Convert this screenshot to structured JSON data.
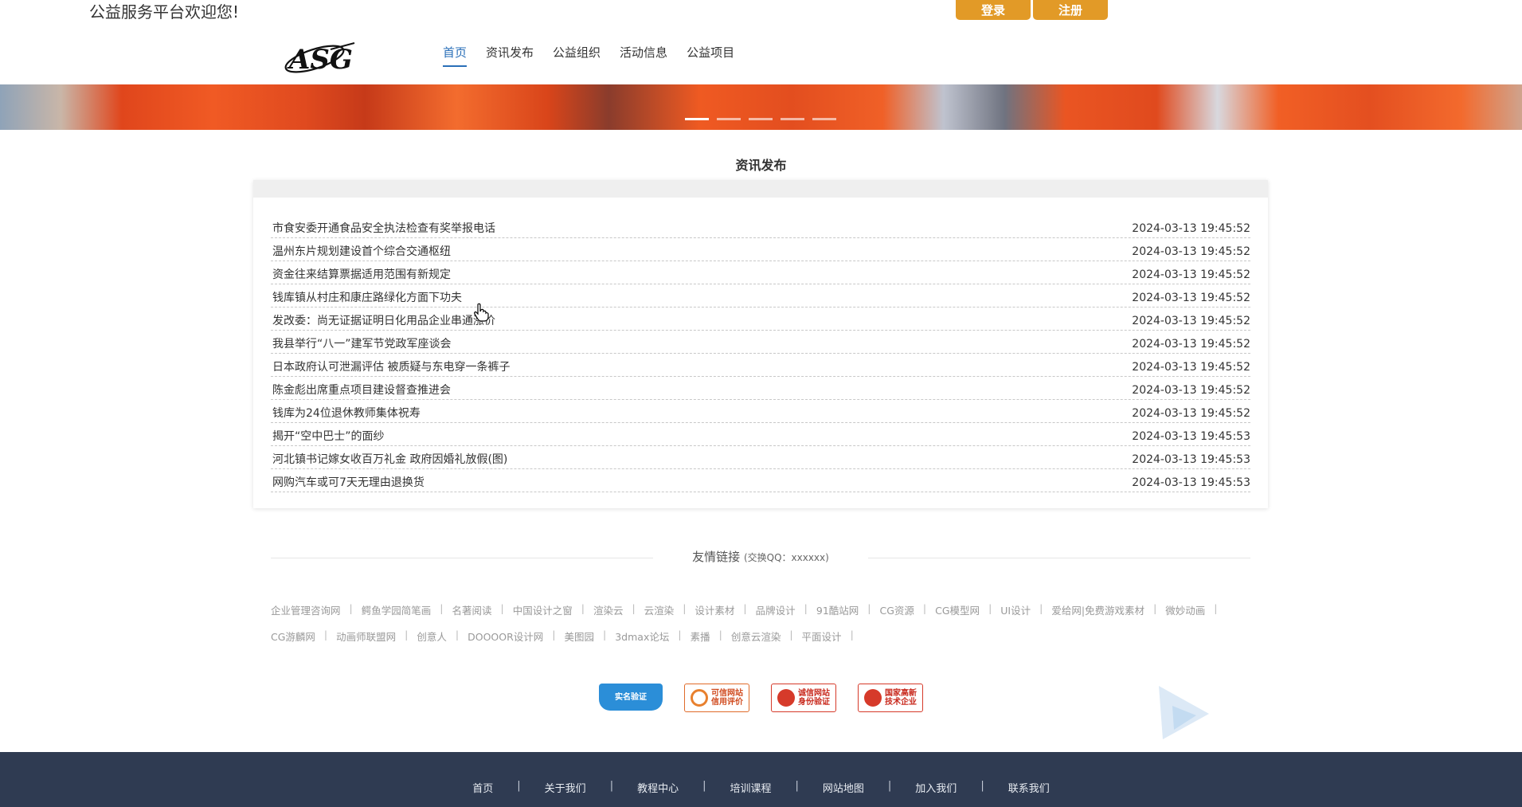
{
  "topbar": {
    "welcome": "公益服务平台欢迎您!",
    "login_label": "登录",
    "register_label": "注册"
  },
  "nav": {
    "items": [
      {
        "label": "首页",
        "active": true
      },
      {
        "label": "资讯发布",
        "active": false
      },
      {
        "label": "公益组织",
        "active": false
      },
      {
        "label": "活动信息",
        "active": false
      },
      {
        "label": "公益项目",
        "active": false
      }
    ]
  },
  "banner": {
    "slide_count": 5,
    "active_slide": 1
  },
  "news": {
    "title": "资讯发布",
    "items": [
      {
        "title": "市食安委开通食品安全执法检查有奖举报电话",
        "date": "2024-03-13 19:45:52"
      },
      {
        "title": "温州东片规划建设首个综合交通枢纽",
        "date": "2024-03-13 19:45:52"
      },
      {
        "title": "资金往来结算票据适用范围有新规定",
        "date": "2024-03-13 19:45:52"
      },
      {
        "title": "钱库镇从村庄和康庄路绿化方面下功夫",
        "date": "2024-03-13 19:45:52"
      },
      {
        "title": "发改委：尚无证据证明日化用品企业串通涨价",
        "date": "2024-03-13 19:45:52"
      },
      {
        "title": "我县举行“八一”建军节党政军座谈会",
        "date": "2024-03-13 19:45:52"
      },
      {
        "title": "日本政府认可泄漏评估 被质疑与东电穿一条裤子",
        "date": "2024-03-13 19:45:52"
      },
      {
        "title": "陈金彪出席重点项目建设督查推进会",
        "date": "2024-03-13 19:45:52"
      },
      {
        "title": "钱库为24位退休教师集体祝寿",
        "date": "2024-03-13 19:45:52"
      },
      {
        "title": "揭开“空中巴士”的面纱",
        "date": "2024-03-13 19:45:53"
      },
      {
        "title": "河北镇书记嫁女收百万礼金 政府因婚礼放假(图)",
        "date": "2024-03-13 19:45:53"
      },
      {
        "title": "网购汽车或可7天无理由退换货",
        "date": "2024-03-13 19:45:53"
      }
    ]
  },
  "friend_links": {
    "title": "友情链接",
    "qq_note": "(交换QQ：xxxxxx)",
    "row1": [
      "企业管理咨询网",
      "鳄鱼学园简笔画",
      "名著阅读",
      "中国设计之窗",
      "渲染云",
      "云渲染",
      "设计素材",
      "品牌设计",
      "91酷站网",
      "CG资源",
      "CG模型网",
      "UI设计",
      "爱给网|免费游戏素材",
      "微妙动画"
    ],
    "row2": [
      "CG游麟网",
      "动画师联盟网",
      "创意人",
      "DOOOOR设计网",
      "美图园",
      "3dmax论坛",
      "素播",
      "创意云渲染",
      "平面设计"
    ]
  },
  "badges": [
    {
      "name": "实名验证",
      "sub": "实名验证"
    },
    {
      "name": "可信网站",
      "sub": "信用评价"
    },
    {
      "name": "诚信网站",
      "sub": "身份验证"
    },
    {
      "name": "国家高新",
      "sub": "技术企业"
    }
  ],
  "footer": {
    "links": [
      "首页",
      "关于我们",
      "教程中心",
      "培训课程",
      "网站地图",
      "加入我们",
      "联系我们"
    ]
  },
  "colors": {
    "accent": "#e29a27",
    "nav_active": "#2a6fb8",
    "footer_bg": "#2f3b52"
  }
}
